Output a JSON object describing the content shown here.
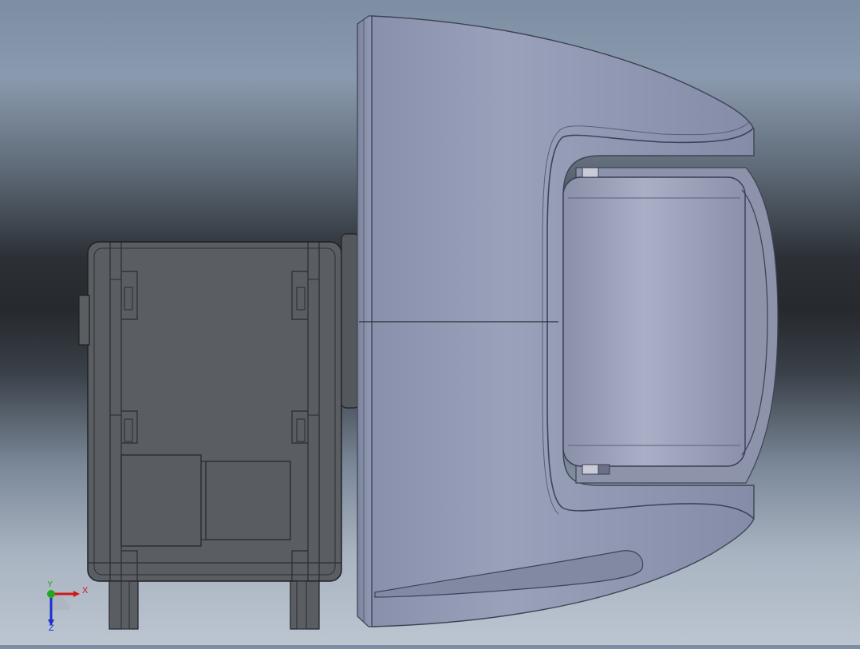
{
  "viewport": {
    "background_top": "#7d8ea3",
    "background_mid": "#26292d",
    "background_bottom": "#bcc5d0"
  },
  "model": {
    "shell_color": "#9097b1",
    "shell_shade": "#7d849d",
    "servo_color": "#575a5f",
    "servo_edge": "#2a2c30",
    "wheel_color": "#9aa0b8"
  },
  "triad": {
    "x_label": "X",
    "y_label": "Y",
    "z_label": "Z",
    "x_color": "#d01818",
    "y_color": "#1fa81f",
    "z_color": "#1a2fd0"
  }
}
